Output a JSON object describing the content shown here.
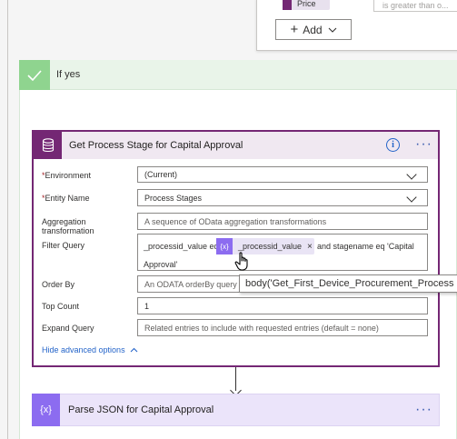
{
  "condition": {
    "token_label": "Price",
    "operator_placeholder": "is greater than o...",
    "add_label": "Add"
  },
  "branch": {
    "label": "If yes"
  },
  "action": {
    "title": "Get Process Stage for Capital Approval",
    "fields": {
      "environment": {
        "label": "Environment",
        "value": "(Current)"
      },
      "entity_name": {
        "label": "Entity Name",
        "value": "Process Stages"
      },
      "aggregation": {
        "label_line1": "Aggregation",
        "label_line2": "transformation",
        "placeholder": "A sequence of OData aggregation transformations"
      },
      "filter_query": {
        "label": "Filter Query",
        "text_before": "_processid_value eq",
        "token_label": "_processid_value",
        "token_icon": "{x}",
        "text_after": "and stagename eq 'Capital",
        "text_line2": "Approval'"
      },
      "order_by": {
        "label": "Order By",
        "placeholder": "An ODATA orderBy query f"
      },
      "top_count": {
        "label": "Top Count",
        "value": "1"
      },
      "expand_query": {
        "label": "Expand Query",
        "placeholder": "Related entries to include with requested entries (default = none)"
      }
    },
    "tooltip": "body('Get_First_Device_Procurement_Process",
    "hide_advanced_label": "Hide advanced options"
  },
  "next_action": {
    "title": "Parse JSON for Capital Approval",
    "icon": "{x}"
  },
  "colors": {
    "dataverse_purple": "#742774",
    "expression_purple": "#8c6cf0",
    "branch_green": "#8fd48f",
    "link_blue": "#2464c9"
  },
  "icons": [
    "database-icon",
    "info-icon",
    "more-icon",
    "check-icon",
    "chevron-down-icon",
    "expression-icon",
    "close-icon",
    "hand-cursor-icon",
    "arrow-down-icon"
  ]
}
